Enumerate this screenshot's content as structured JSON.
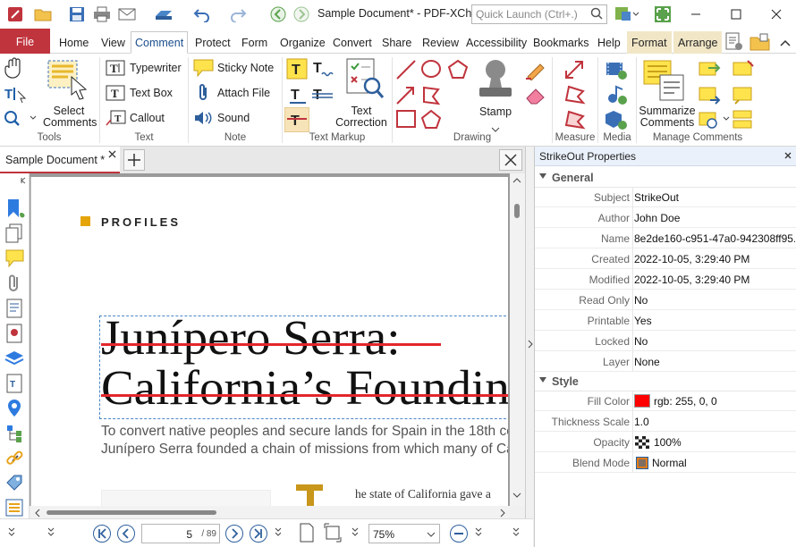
{
  "window": {
    "title": "Sample Document* - PDF-XCh..."
  },
  "quick_launch": {
    "placeholder": "Quick Launch (Ctrl+.)"
  },
  "menu": {
    "file": "File",
    "tabs": [
      "Home",
      "View",
      "Comment",
      "Protect",
      "Form",
      "Organize",
      "Convert",
      "Share",
      "Review",
      "Accessibility",
      "Bookmarks",
      "Help"
    ],
    "context_tabs": [
      "Format",
      "Arrange"
    ],
    "active": "Comment"
  },
  "ribbon": {
    "tools": {
      "label": "Tools",
      "select_comments": "Select Comments"
    },
    "text": {
      "label": "Text",
      "typewriter": "Typewriter",
      "text_box": "Text Box",
      "callout": "Callout"
    },
    "note": {
      "label": "Note",
      "sticky_note": "Sticky Note",
      "attach_file": "Attach File",
      "sound": "Sound"
    },
    "text_markup": {
      "label": "Text Markup",
      "text_correction": "Text Correction"
    },
    "drawing": {
      "label": "Drawing",
      "stamp": "Stamp"
    },
    "measure": {
      "label": "Measure"
    },
    "media": {
      "label": "Media"
    },
    "manage": {
      "label": "Manage Comments",
      "summarize": "Summarize Comments"
    }
  },
  "doc_tab": {
    "name": "Sample Document *"
  },
  "document": {
    "section_heading": "PROFILES",
    "title_line1": "Junípero Serra:",
    "title_line2": "California’s Foundin",
    "para_line1": "To convert native peoples and secure lands for Spain in the 18th ce",
    "para_line2": "Junípero Serra founded a chain of missions from which many of Ca",
    "body_snippet": "he state of California gave a"
  },
  "navigation": {
    "page_current": "5",
    "page_total": "/ 89",
    "zoom": "75%"
  },
  "properties": {
    "title": "StrikeOut Properties",
    "sections": {
      "general": "General",
      "style": "Style"
    },
    "general": [
      {
        "key": "Subject",
        "value": "StrikeOut"
      },
      {
        "key": "Author",
        "value": "John Doe"
      },
      {
        "key": "Name",
        "value": "8e2de160-c951-47a0-942308ff95..."
      },
      {
        "key": "Created",
        "value": "2022-10-05, 3:29:40 PM"
      },
      {
        "key": "Modified",
        "value": "2022-10-05, 3:29:40 PM"
      },
      {
        "key": "Read Only",
        "value": "No"
      },
      {
        "key": "Printable",
        "value": "Yes"
      },
      {
        "key": "Locked",
        "value": "No"
      },
      {
        "key": "Layer",
        "value": "None"
      }
    ],
    "style": [
      {
        "key": "Fill Color",
        "value": "rgb: 255, 0, 0"
      },
      {
        "key": "Thickness Scale",
        "value": "1.0"
      },
      {
        "key": "Opacity",
        "value": "100%"
      },
      {
        "key": "Blend Mode",
        "value": "Normal"
      }
    ]
  },
  "colors": {
    "accent": "#c0343d",
    "strike": "#e3262b",
    "fill_color": "#ff0000",
    "heading_square": "#e5a50a",
    "blend_swatch": "#e07b1a"
  }
}
